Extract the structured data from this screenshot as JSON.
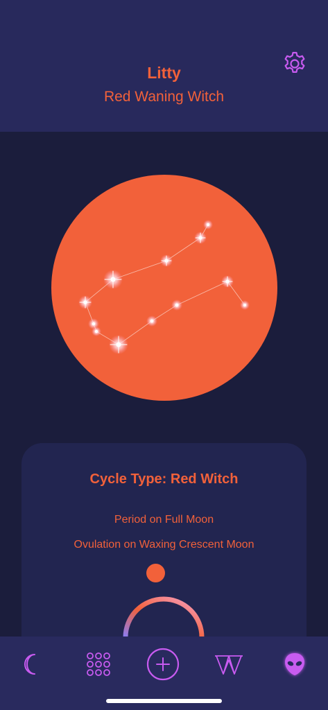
{
  "header": {
    "name": "Litty",
    "subtitle": "Red Waning Witch",
    "settings_icon": "gear-icon"
  },
  "moon": {
    "fill_color": "#f2613a",
    "constellation_icon": "gemini-constellation-icon"
  },
  "cycle_card": {
    "title": "Cycle Type: Red Witch",
    "period_text": "Period on Full Moon",
    "ovulation_text": "Ovulation on Waxing Crescent Moon"
  },
  "nav": {
    "items": [
      {
        "icon": "crescent-moon-icon"
      },
      {
        "icon": "dot-grid-icon"
      },
      {
        "icon": "add-circle-icon"
      },
      {
        "icon": "witch-w-icon"
      },
      {
        "icon": "alien-icon",
        "active": true
      }
    ]
  },
  "colors": {
    "accent": "#f2613a",
    "nav_icon": "#c85bf0",
    "header_bg": "#28295c",
    "page_bg": "#1b1d3c",
    "card_bg": "#222550"
  }
}
